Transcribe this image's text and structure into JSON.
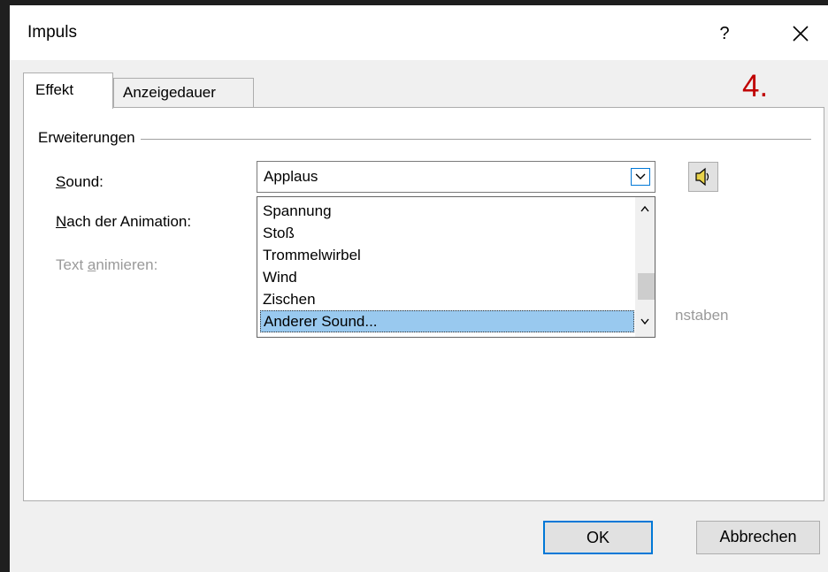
{
  "dialog": {
    "title": "Impuls",
    "help_label": "?",
    "close_label": "✕"
  },
  "tabs": [
    {
      "label": "Effekt",
      "active": true
    },
    {
      "label": "Anzeigedauer",
      "active": false
    }
  ],
  "annotation": "4.",
  "group": {
    "label": "Erweiterungen"
  },
  "fields": {
    "sound": {
      "accel": "S",
      "rest": "ound:",
      "value": "Applaus"
    },
    "after_animation": {
      "accel": "N",
      "rest": "ach der Animation:"
    },
    "animate_text": {
      "pre": "Text ",
      "accel": "a",
      "rest": "nimieren:"
    }
  },
  "dropdown": {
    "items": [
      "Spannung",
      "Stoß",
      "Trommelwirbel",
      "Wind",
      "Zischen",
      "Anderer Sound..."
    ],
    "selected_index": 5
  },
  "partial_text": "nstaben",
  "buttons": {
    "ok": "OK",
    "cancel": "Abbrechen"
  },
  "colors": {
    "accent": "#0078d7",
    "selection": "#99c9ef",
    "annotation": "#c00000"
  }
}
